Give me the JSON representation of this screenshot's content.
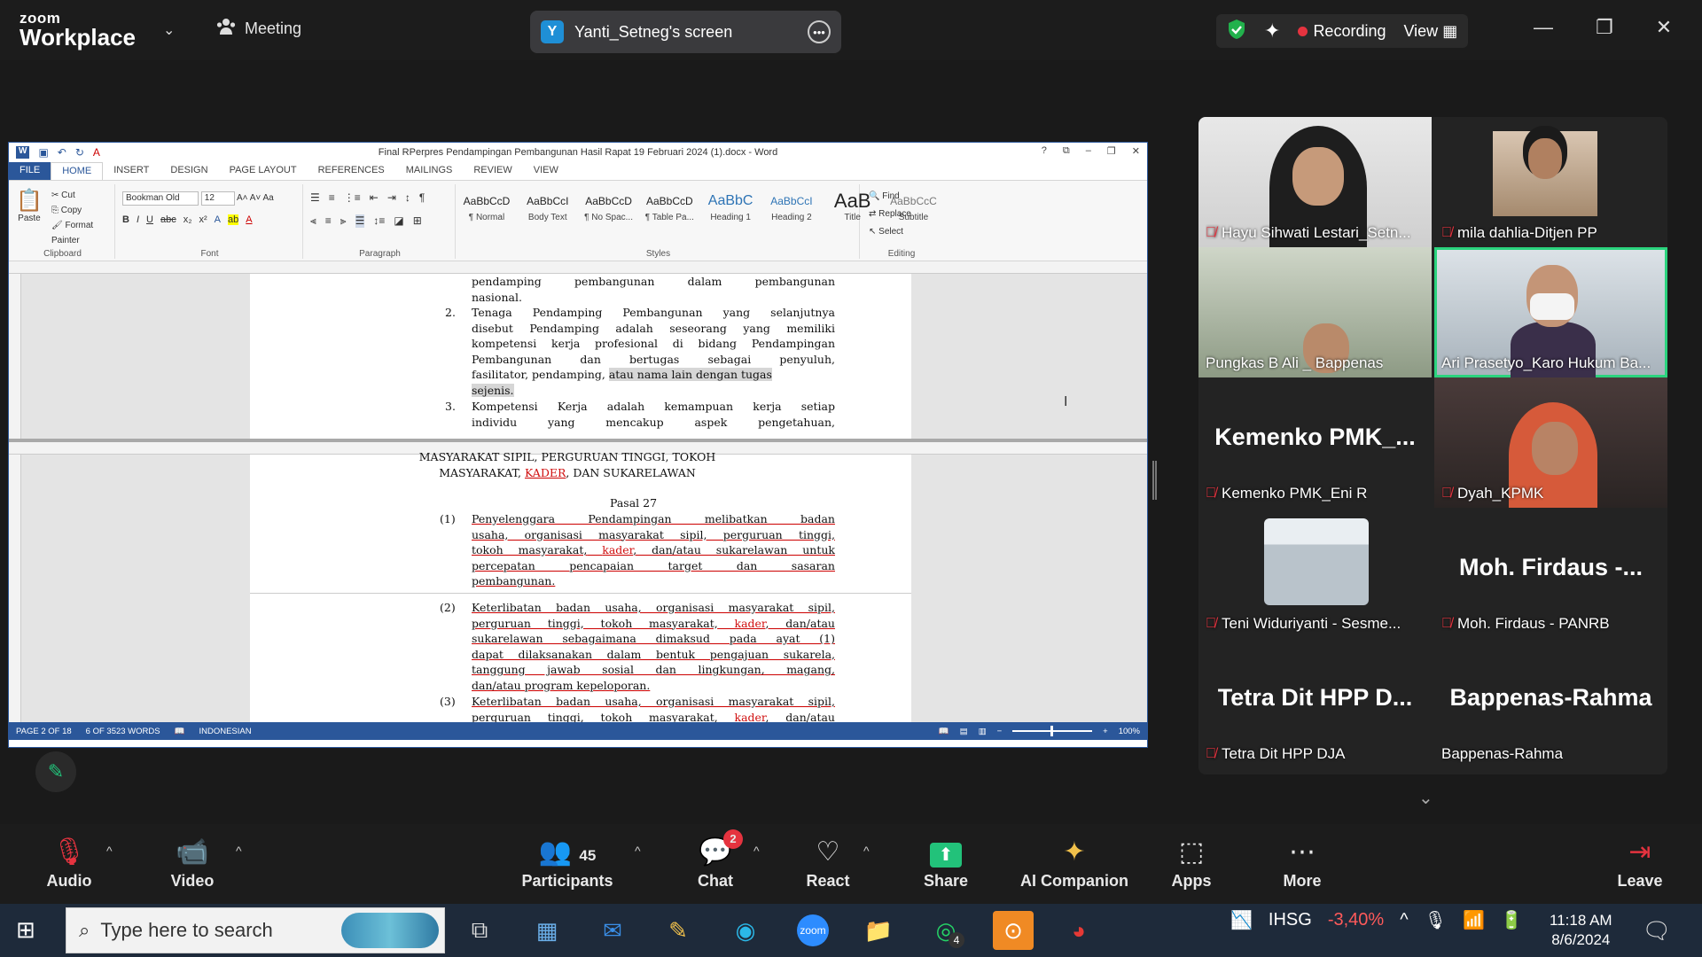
{
  "zoom": {
    "brand_top": "zoom",
    "brand_main": "Workplace",
    "meeting_label": "Meeting",
    "screen_share_initial": "Y",
    "screen_share_label": "Yanti_Setneg's screen",
    "recording_label": "Recording",
    "view_label": "View"
  },
  "word": {
    "title": "Final RPerpres Pendampingan Pembangunan Hasil Rapat 19 Februari 2024 (1).docx - Word",
    "tabs": [
      "FILE",
      "HOME",
      "INSERT",
      "DESIGN",
      "PAGE LAYOUT",
      "REFERENCES",
      "MAILINGS",
      "REVIEW",
      "VIEW"
    ],
    "clipboard": {
      "paste": "Paste",
      "cut": "Cut",
      "copy": "Copy",
      "format_painter": "Format Painter",
      "label": "Clipboard"
    },
    "font": {
      "name": "Bookman Old",
      "size": "12",
      "label": "Font"
    },
    "paragraph_label": "Paragraph",
    "styles": [
      {
        "preview": "AaBbCcD",
        "name": "¶ Normal"
      },
      {
        "preview": "AaBbCcI",
        "name": "Body Text"
      },
      {
        "preview": "AaBbCcD",
        "name": "¶ No Spac..."
      },
      {
        "preview": "AaBbCcD",
        "name": "¶ Table Pa..."
      },
      {
        "preview": "AaBbC",
        "name": "Heading 1"
      },
      {
        "preview": "AaBbCcI",
        "name": "Heading 2"
      },
      {
        "preview": "AaB",
        "name": "Title"
      },
      {
        "preview": "AaBbCcC",
        "name": "Subtitle"
      }
    ],
    "styles_label": "Styles",
    "editing": {
      "find": "Find",
      "replace": "Replace",
      "select": "Select",
      "label": "Editing"
    },
    "pane1": {
      "line_a1": "pendamping pembangunan dalam pembangunan",
      "line_a2": "nasional.",
      "item2_num": "2.",
      "item2_lines": [
        "Tenaga Pendamping Pembangunan yang selanjutnya",
        "disebut Pendamping adalah seseorang yang memiliki",
        "kompetensi kerja profesional di bidang Pendampingan",
        "Pembangunan dan bertugas sebagai penyuluh,"
      ],
      "item2_l5a": "fasilitator, pendamping,",
      "item2_l5b": "atau nama lain dengan tugas",
      "item2_l6": "sejenis.",
      "item3_num": "3.",
      "item3_lines": [
        "Kompetensi Kerja adalah kemampuan kerja setiap",
        "individu yang mencakup aspek pengetahuan,"
      ]
    },
    "pane2": {
      "heading_l1": "MASYARAKAT SIPIL, PERGURUAN TINGGI, TOKOH",
      "heading_l2a": "MASYARAKAT,",
      "heading_l2b": "KADER",
      "heading_l2c": ", DAN SUKARELAWAN",
      "pasal": "Pasal 27",
      "p1_num": "(1)",
      "p1_l1": "Penyelenggara Pendampingan melibatkan badan",
      "p1_l2": "usaha, organisasi masyarakat sipil, perguruan tinggi,",
      "p1_l3a": "tokoh masyarakat,",
      "p1_l3b": "kader",
      "p1_l3c": ", dan/atau sukarelawan untuk",
      "p1_l4": "percepatan pencapaian target dan sasaran",
      "p1_l5": "pembangunan.",
      "p2_num": "(2)",
      "p2_l1": "Keterlibatan badan usaha, organisasi masyarakat sipil,",
      "p2_l2a": "perguruan tinggi, tokoh masyarakat,",
      "p2_l2b": "kader",
      "p2_l2c": ", dan/atau",
      "p2_l3": "sukarelawan sebagaimana dimaksud pada ayat (1)",
      "p2_l4": "dapat dilaksanakan dalam bentuk pengajuan sukarela,",
      "p2_l5": "tanggung jawab sosial dan lingkungan, magang,",
      "p2_l6": "dan/atau program kepeloporan.",
      "p3_num": "(3)",
      "p3_l1": "Keterlibatan badan usaha, organisasi masyarakat sipil,",
      "p3_l2a": "perguruan tinggi, tokoh masyarakat,",
      "p3_l2b": "kader",
      "p3_l2c": ", dan/atau"
    },
    "status": {
      "page": "PAGE 2 OF 18",
      "words": "6 OF 3523 WORDS",
      "language": "INDONESIAN",
      "zoom": "100%"
    }
  },
  "participants": [
    {
      "name": "Hayu Sihwati Lestari_Setn...",
      "muted": true
    },
    {
      "name": "mila dahlia-Ditjen PP",
      "muted": true
    },
    {
      "name": "Pungkas B Ali _ Bappenas",
      "muted": false
    },
    {
      "name": "Ari Prasetyo_Karo Hukum Ba...",
      "muted": false,
      "active": true
    },
    {
      "name": "Kemenko PMK_Eni R",
      "muted": true,
      "display": "Kemenko PMK_..."
    },
    {
      "name": "Dyah_KPMK",
      "muted": true
    },
    {
      "name": "Teni Widuriyanti - Sesme...",
      "muted": true
    },
    {
      "name": "Moh. Firdaus - PANRB",
      "muted": true,
      "display": "Moh. Firdaus -..."
    },
    {
      "name": "Tetra Dit HPP DJA",
      "muted": true,
      "display": "Tetra Dit HPP D..."
    },
    {
      "name": "Bappenas-Rahma",
      "muted": false,
      "display": "Bappenas-Rahma"
    }
  ],
  "controls": {
    "audio": "Audio",
    "video": "Video",
    "participants": "Participants",
    "participants_count": "45",
    "chat": "Chat",
    "chat_badge": "2",
    "react": "React",
    "share": "Share",
    "ai": "AI Companion",
    "apps": "Apps",
    "more": "More",
    "leave": "Leave"
  },
  "taskbar": {
    "search_placeholder": "Type here to search",
    "whatsapp_badge": "4",
    "stock_symbol": "IHSG",
    "stock_change": "-3,40%",
    "time": "11:18 AM",
    "date": "8/6/2024"
  },
  "colors": {
    "accent_green": "#2bd47e",
    "recording_red": "#e5333f",
    "word_blue": "#2b579a",
    "zoom_bg": "#1a1a1a"
  }
}
